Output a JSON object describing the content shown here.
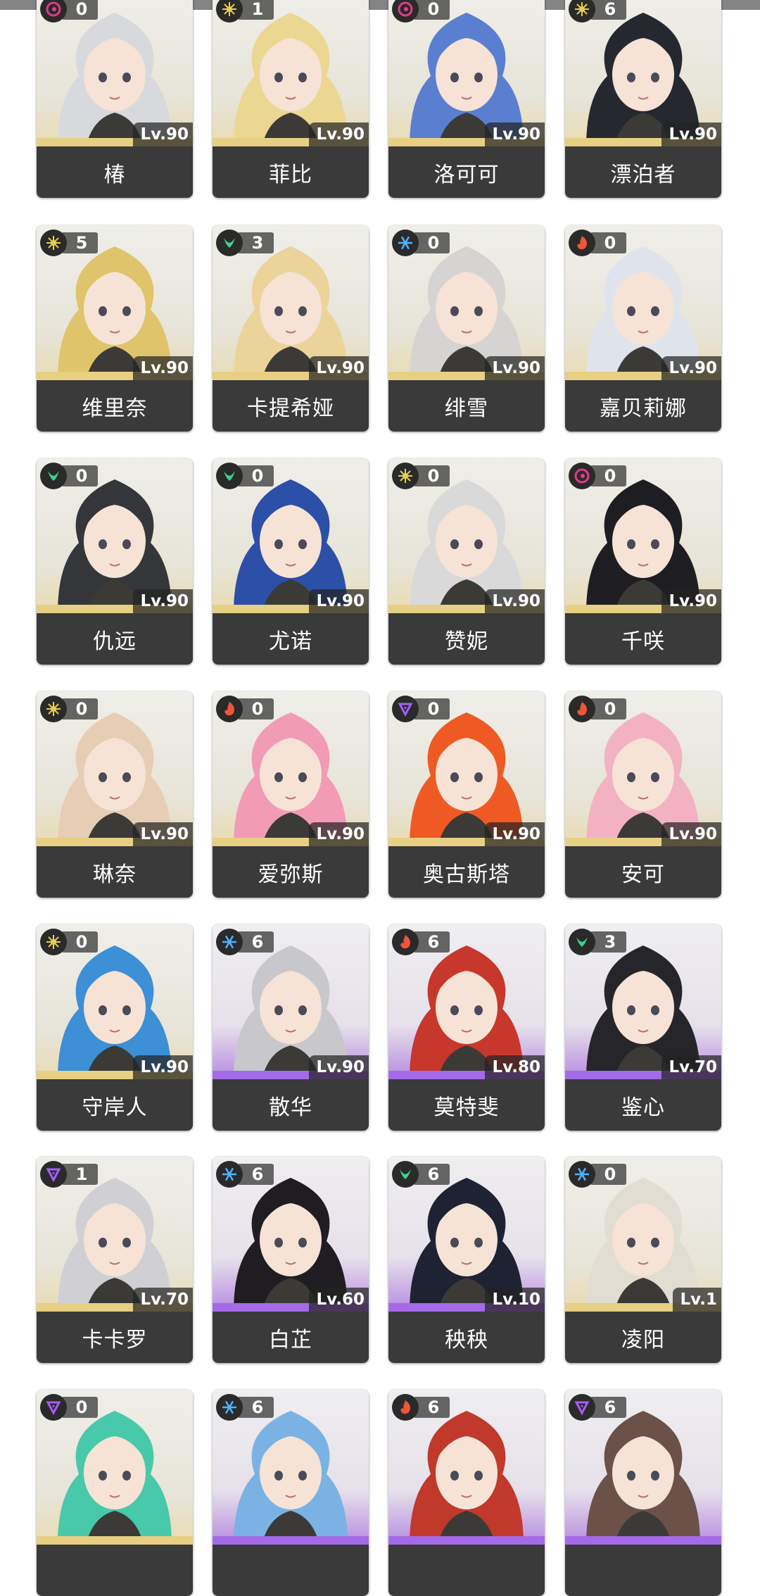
{
  "colors": {
    "rarity_gold": "#e7cf83",
    "rarity_purple": "#a56ae8",
    "name_bar": "#3a3a3a",
    "elements": {
      "spectro": "#e8cf4a",
      "havoc": "#e23b8a",
      "aero": "#3fd18f",
      "glacio": "#4fb3ff",
      "fusion": "#f0553a",
      "electro": "#a65cff"
    }
  },
  "characters": [
    {
      "name": "椿",
      "element": "havoc-icon",
      "rank": "0",
      "level": "Lv.90",
      "rarity": "gold",
      "hair": "#d8d9dc"
    },
    {
      "name": "菲比",
      "element": "spectro-icon",
      "rank": "1",
      "level": "Lv.90",
      "rarity": "gold",
      "hair": "#ecd792"
    },
    {
      "name": "洛可可",
      "element": "havoc-icon",
      "rank": "0",
      "level": "Lv.90",
      "rarity": "gold",
      "hair": "#5b7fd0"
    },
    {
      "name": "漂泊者",
      "element": "spectro-icon",
      "rank": "6",
      "level": "Lv.90",
      "rarity": "gold",
      "hair": "#262830"
    },
    {
      "name": "维里奈",
      "element": "spectro-icon",
      "rank": "5",
      "level": "Lv.90",
      "rarity": "gold",
      "hair": "#e0c46b"
    },
    {
      "name": "卡提希娅",
      "element": "aero-icon",
      "rank": "3",
      "level": "Lv.90",
      "rarity": "gold",
      "hair": "#ecd39a"
    },
    {
      "name": "绯雪",
      "element": "glacio-icon",
      "rank": "0",
      "level": "Lv.90",
      "rarity": "gold",
      "hair": "#d6d4d2"
    },
    {
      "name": "嘉贝莉娜",
      "element": "fusion-icon",
      "rank": "0",
      "level": "Lv.90",
      "rarity": "gold",
      "hair": "#dfe4ec"
    },
    {
      "name": "仇远",
      "element": "aero-icon",
      "rank": "0",
      "level": "Lv.90",
      "rarity": "gold",
      "hair": "#34363a"
    },
    {
      "name": "尤诺",
      "element": "aero-icon",
      "rank": "0",
      "level": "Lv.90",
      "rarity": "gold",
      "hair": "#2c4fa8"
    },
    {
      "name": "赞妮",
      "element": "spectro-icon",
      "rank": "0",
      "level": "Lv.90",
      "rarity": "gold",
      "hair": "#d9d9d9"
    },
    {
      "name": "千咲",
      "element": "havoc-icon",
      "rank": "0",
      "level": "Lv.90",
      "rarity": "gold",
      "hair": "#1e1e22"
    },
    {
      "name": "琳奈",
      "element": "spectro-icon",
      "rank": "0",
      "level": "Lv.90",
      "rarity": "gold",
      "hair": "#e6cdb4"
    },
    {
      "name": "爱弥斯",
      "element": "fusion-icon",
      "rank": "0",
      "level": "Lv.90",
      "rarity": "gold",
      "hair": "#f29bb6"
    },
    {
      "name": "奥古斯塔",
      "element": "electro-icon",
      "rank": "0",
      "level": "Lv.90",
      "rarity": "gold",
      "hair": "#ef5a24"
    },
    {
      "name": "安可",
      "element": "fusion-icon",
      "rank": "0",
      "level": "Lv.90",
      "rarity": "gold",
      "hair": "#f3b2c2"
    },
    {
      "name": "守岸人",
      "element": "spectro-icon",
      "rank": "0",
      "level": "Lv.90",
      "rarity": "gold",
      "hair": "#3d8fd6"
    },
    {
      "name": "散华",
      "element": "glacio-icon",
      "rank": "6",
      "level": "Lv.90",
      "rarity": "purple",
      "hair": "#c8c8cc"
    },
    {
      "name": "莫特斐",
      "element": "fusion-icon",
      "rank": "6",
      "level": "Lv.80",
      "rarity": "purple",
      "hair": "#c8372c"
    },
    {
      "name": "鉴心",
      "element": "aero-icon",
      "rank": "3",
      "level": "Lv.70",
      "rarity": "purple",
      "hair": "#26262a"
    },
    {
      "name": "卡卡罗",
      "element": "electro-icon",
      "rank": "1",
      "level": "Lv.70",
      "rarity": "gold",
      "hair": "#d0d0d4"
    },
    {
      "name": "白芷",
      "element": "glacio-icon",
      "rank": "6",
      "level": "Lv.60",
      "rarity": "purple",
      "hair": "#1f1d22"
    },
    {
      "name": "秧秧",
      "element": "aero-icon",
      "rank": "6",
      "level": "Lv.10",
      "rarity": "purple",
      "hair": "#1e2233"
    },
    {
      "name": "凌阳",
      "element": "glacio-icon",
      "rank": "0",
      "level": "Lv.1",
      "rarity": "gold",
      "hair": "#e2ddd3"
    },
    {
      "name": "",
      "element": "electro-icon",
      "rank": "0",
      "level": "",
      "rarity": "gold",
      "hair": "#48c9a9"
    },
    {
      "name": "",
      "element": "glacio-icon",
      "rank": "6",
      "level": "",
      "rarity": "purple",
      "hair": "#7ab3e3"
    },
    {
      "name": "",
      "element": "fusion-icon",
      "rank": "6",
      "level": "",
      "rarity": "purple",
      "hair": "#c0392b"
    },
    {
      "name": "",
      "element": "electro-icon",
      "rank": "6",
      "level": "",
      "rarity": "purple",
      "hair": "#6b5148"
    }
  ]
}
